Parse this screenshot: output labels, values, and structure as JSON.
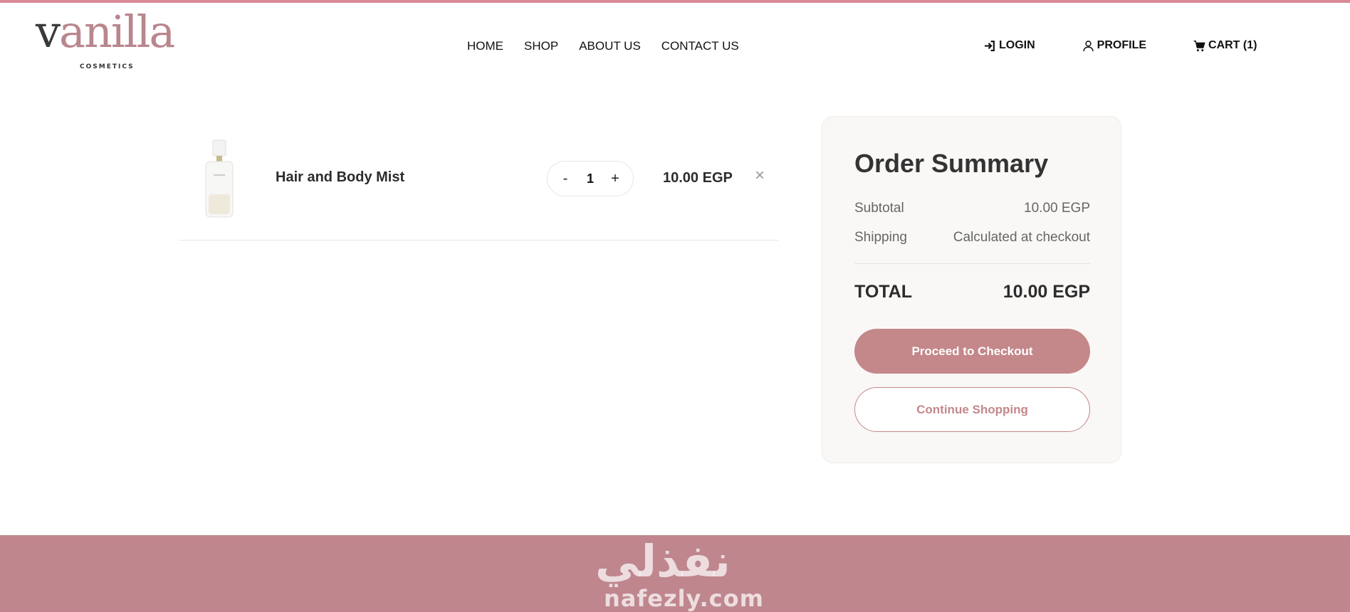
{
  "brand": {
    "logo_main": "vanilla",
    "logo_first_letter": "v",
    "logo_rest": "anilla",
    "logo_sub": "COSMETICS"
  },
  "nav": {
    "items": [
      "HOME",
      "SHOP",
      "ABOUT US",
      "CONTACT US"
    ]
  },
  "actions": {
    "login": "LOGIN",
    "profile": "PROFILE",
    "cart": "CART (1)"
  },
  "cart": {
    "items": [
      {
        "name": "Hair and Body Mist",
        "quantity": "1",
        "price": "10.00 EGP",
        "minus": "-",
        "plus": "+",
        "remove": "×"
      }
    ]
  },
  "summary": {
    "title": "Order Summary",
    "subtotal_label": "Subtotal",
    "subtotal_value": "10.00 EGP",
    "shipping_label": "Shipping",
    "shipping_value": "Calculated at checkout",
    "total_label": "TOTAL",
    "total_value": "10.00 EGP",
    "checkout_label": "Proceed to Checkout",
    "continue_label": "Continue Shopping"
  },
  "footer": {
    "watermark_arabic": "نفذلي",
    "watermark_latin": "nafezly.com"
  },
  "colors": {
    "accent": "#c4878a",
    "footer": "#bf868e",
    "top_strip": "#d98a96",
    "summary_bg": "#faf8f6"
  }
}
